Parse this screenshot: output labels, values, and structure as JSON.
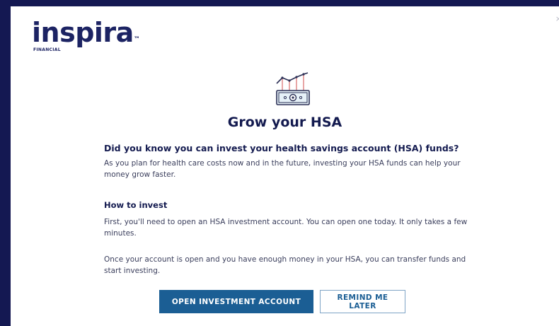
{
  "brand": {
    "name": "inspira",
    "trademark": "™",
    "sub": "FINANCIAL"
  },
  "dialog": {
    "close_glyph": "×",
    "illustration_icon": "money-growth-icon",
    "title": "Grow your HSA",
    "question": "Did you know you can invest your health savings account (HSA) funds?",
    "intro": "As you plan for health care costs now and in the future, investing your HSA funds can help your money grow faster.",
    "how_heading": "How to invest",
    "step1": "First, you'll need to open an HSA investment account. You can open one today. It only takes a few minutes.",
    "step2": "Once your account is open and you have enough money in your HSA, you can transfer funds and start investing.",
    "primary_button": "OPEN INVESTMENT ACCOUNT",
    "secondary_button": "REMIND ME LATER"
  },
  "colors": {
    "backdrop": "#141852",
    "navy": "#131a4f",
    "primary": "#1b5e94",
    "secondary_border": "#7fa4c6",
    "illustration_accent": "#e8a6a6"
  }
}
